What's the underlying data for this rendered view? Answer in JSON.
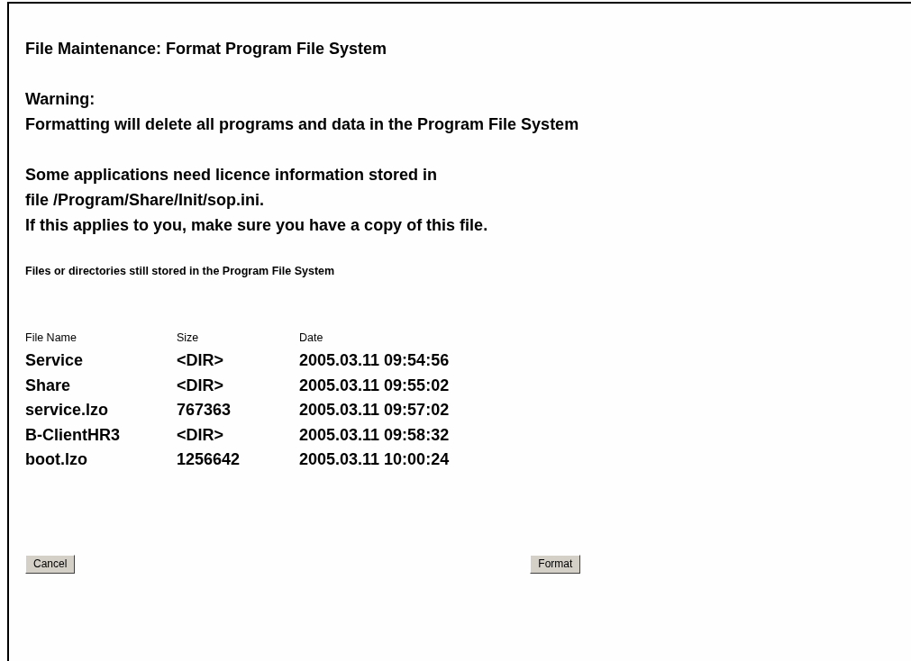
{
  "title": "File Maintenance: Format Program File System",
  "warning": {
    "label": "Warning:",
    "text": "Formatting will delete all programs and data in the Program File System"
  },
  "notice": [
    "Some applications need licence information stored in",
    "file /Program/Share/Init/sop.ini.",
    "If this applies to you, make sure you have a copy of this file."
  ],
  "files_heading": "Files or directories still stored in the Program File System",
  "table": {
    "columns": [
      "File Name",
      "Size",
      "Date"
    ],
    "rows": [
      [
        "Service",
        "<DIR>",
        "2005.03.11 09:54:56"
      ],
      [
        "Share",
        "<DIR>",
        "2005.03.11 09:55:02"
      ],
      [
        "service.lzo",
        "767363",
        "2005.03.11 09:57:02"
      ],
      [
        "B-ClientHR3",
        "<DIR>",
        "2005.03.11 09:58:32"
      ],
      [
        "boot.lzo",
        "1256642",
        "2005.03.11 10:00:24"
      ]
    ]
  },
  "buttons": [
    "Cancel",
    "Format"
  ]
}
